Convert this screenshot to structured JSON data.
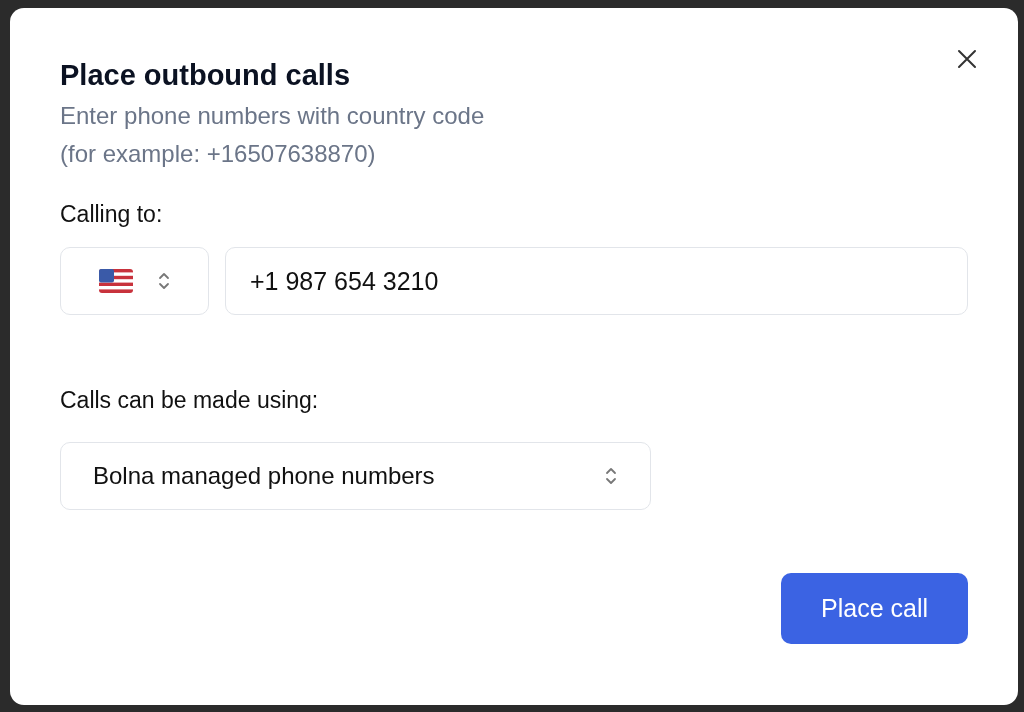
{
  "dialog": {
    "title": "Place outbound calls",
    "subtitle_lines": [
      "Enter phone numbers with country code",
      "(for example: +16507638870)"
    ],
    "calling_to": {
      "label": "Calling to:",
      "phone_value": "+1 987 654 3210"
    },
    "provider": {
      "label": "Calls can be made using:",
      "value": "Bolna managed phone numbers"
    },
    "buttons": [
      "Place call"
    ]
  }
}
